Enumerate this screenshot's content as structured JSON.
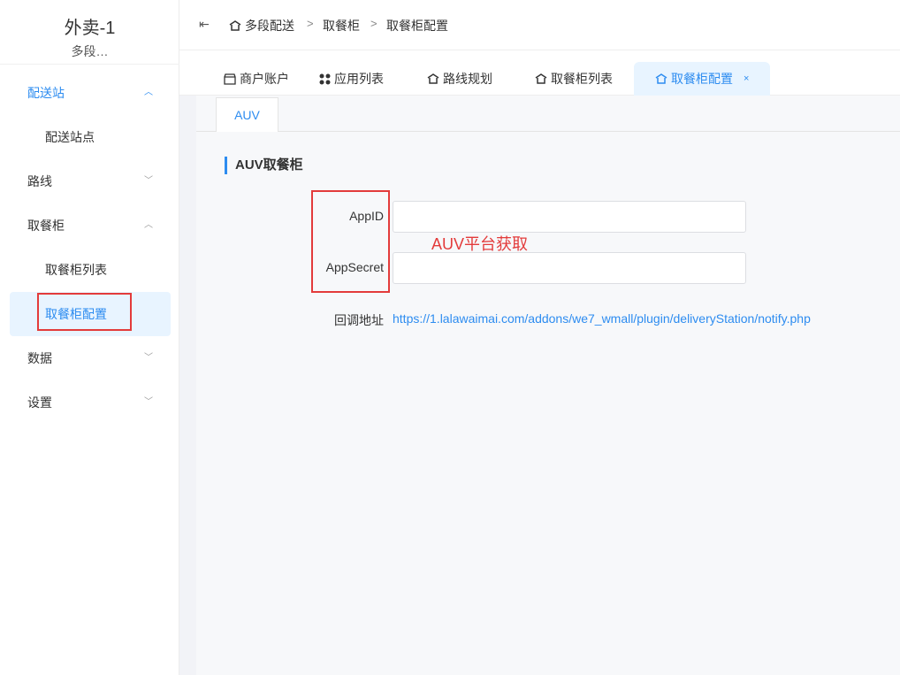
{
  "brand": {
    "title": "外卖-1",
    "subtitle": "多段…"
  },
  "sidebar": {
    "items": [
      {
        "label": "配送站",
        "chevron": "︿"
      },
      {
        "label": "配送站点"
      },
      {
        "label": "路线",
        "chevron": "﹀"
      },
      {
        "label": "取餐柜",
        "chevron": "︿"
      },
      {
        "label": "取餐柜列表"
      },
      {
        "label": "取餐柜配置"
      },
      {
        "label": "数据",
        "chevron": "﹀"
      },
      {
        "label": "设置",
        "chevron": "﹀"
      }
    ]
  },
  "header": {
    "collapse_glyph": "⇤",
    "breadcrumb": [
      {
        "label": "多段配送"
      },
      {
        "label": "取餐柜"
      },
      {
        "label": "取餐柜配置"
      }
    ],
    "separator": ">"
  },
  "tabs": [
    {
      "label": "商户账户",
      "icon": "store-icon"
    },
    {
      "label": "应用列表",
      "icon": "apps-icon"
    },
    {
      "label": "路线规划",
      "icon": "home-icon"
    },
    {
      "label": "取餐柜列表",
      "icon": "home-icon"
    },
    {
      "label": "取餐柜配置",
      "icon": "home-icon",
      "close": "×"
    }
  ],
  "panel": {
    "subtab": "AUV",
    "section_title": "AUV取餐柜",
    "fields": {
      "appid": {
        "label": "AppID",
        "value": ""
      },
      "appsecret": {
        "label": "AppSecret",
        "value": ""
      },
      "callback": {
        "label": "回调地址",
        "value": "https://1.lalawaimai.com/addons/we7_wmall/plugin/deliveryStation/notify.php"
      }
    },
    "annotation": "AUV平台获取"
  },
  "colors": {
    "accent": "#2d8cf0",
    "annotation": "#e33b3b",
    "active_bg": "#e8f4ff"
  }
}
